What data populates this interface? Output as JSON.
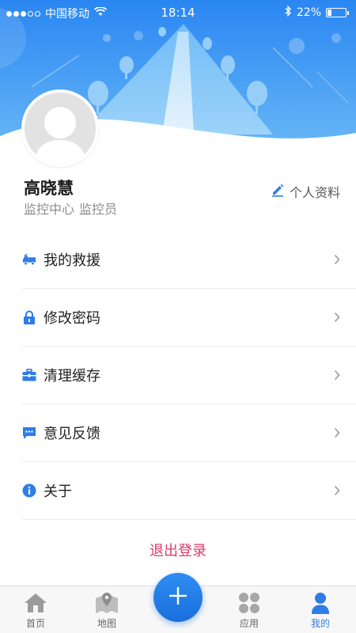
{
  "status_bar": {
    "carrier": "中国移动",
    "time": "18:14",
    "battery_text": "22%",
    "battery_level": 0.22,
    "signal_bars_on": 3,
    "signal_bars_total": 5,
    "icons": [
      "signal-dots-icon",
      "wifi-icon",
      "bluetooth-icon",
      "battery-icon"
    ]
  },
  "profile": {
    "name": "高晓慧",
    "department": "监控中心",
    "role": "监控员",
    "edit_label": "个人资料"
  },
  "menu": {
    "items": [
      {
        "label": "我的救援",
        "icon": "tow-truck-icon"
      },
      {
        "label": "修改密码",
        "icon": "lock-icon"
      },
      {
        "label": "清理缓存",
        "icon": "briefcase-icon"
      },
      {
        "label": "意见反馈",
        "icon": "chat-bubble-icon"
      },
      {
        "label": "关于",
        "icon": "info-icon"
      }
    ]
  },
  "logout_label": "退出登录",
  "tabbar": {
    "tabs": [
      {
        "label": "首页",
        "icon": "home-icon",
        "active": false
      },
      {
        "label": "地图",
        "icon": "map-icon",
        "active": false
      },
      {
        "label": "应用",
        "icon": "apps-icon",
        "active": false
      },
      {
        "label": "我的",
        "icon": "person-icon",
        "active": true
      }
    ],
    "fab_icon": "plus-icon"
  },
  "colors": {
    "header_top": "#2e8df4",
    "header_bottom": "#5fb3f5",
    "accent": "#2f7de6",
    "logout": "#e0396a",
    "icon_blue": "#2f7de6"
  }
}
